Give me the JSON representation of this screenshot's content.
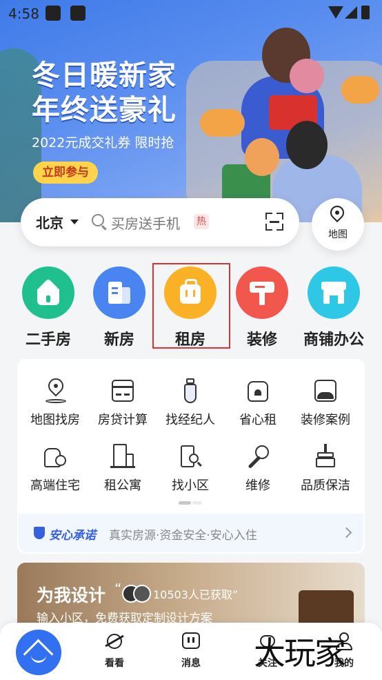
{
  "status_bar": {
    "time": "4:58"
  },
  "banner": {
    "title_line1": "冬日暖新家",
    "title_line2": "年终送豪礼",
    "subtitle": "2022元成交礼券 限时抢",
    "cta": "立即参与"
  },
  "search": {
    "city": "北京",
    "placeholder": "买房送手机",
    "hot_badge": "热"
  },
  "map_button": {
    "label": "地图"
  },
  "categories": [
    {
      "label": "二手房",
      "color": "#20c08e",
      "icon": "house-icon"
    },
    {
      "label": "新房",
      "color": "#4a84f0",
      "icon": "building-icon"
    },
    {
      "label": "租房",
      "color": "#fbb126",
      "icon": "bag-icon"
    },
    {
      "label": "装修",
      "color": "#f1574c",
      "icon": "paint-roller-icon"
    },
    {
      "label": "商铺办公",
      "color": "#2fc7e6",
      "icon": "shop-icon"
    }
  ],
  "tools": [
    {
      "label": "地图找房",
      "icon": "map-pin-icon"
    },
    {
      "label": "房贷计算",
      "icon": "calculator-icon"
    },
    {
      "label": "找经纪人",
      "icon": "tie-icon"
    },
    {
      "label": "省心租",
      "icon": "heart-house-icon"
    },
    {
      "label": "装修案例",
      "icon": "picture-icon"
    },
    {
      "label": "高端住宅",
      "icon": "premium-house-icon"
    },
    {
      "label": "租公寓",
      "icon": "apartment-icon"
    },
    {
      "label": "找小区",
      "icon": "community-search-icon"
    },
    {
      "label": "维修",
      "icon": "wrench-icon"
    },
    {
      "label": "品质保洁",
      "icon": "broom-icon"
    }
  ],
  "promise": {
    "title": "安心承诺",
    "description": "真实房源·资金安全·安心入住"
  },
  "design_card": {
    "title": "为我设计",
    "quote_open": "“",
    "count_text": "10503人已获取",
    "quote_close": "”",
    "subtitle": "输入小区，免费获取定制设计方案"
  },
  "tabbar": {
    "tabs": [
      {
        "label": "看看",
        "icon": "planet-icon"
      },
      {
        "label": "消息",
        "icon": "message-icon"
      },
      {
        "label": "关注",
        "icon": "heart-icon"
      },
      {
        "label": "我的",
        "icon": "user-icon"
      }
    ]
  },
  "watermark": "大玩家",
  "highlight_color": "#e0312f"
}
